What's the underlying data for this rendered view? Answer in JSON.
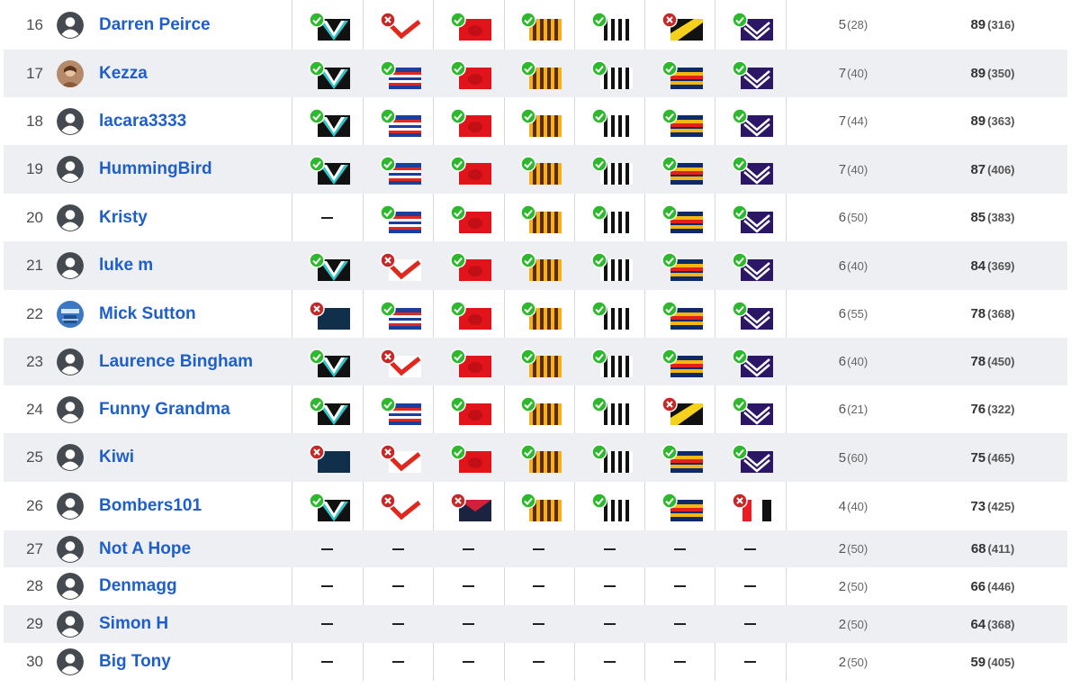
{
  "leaderboard": {
    "rows": [
      {
        "rank": "16",
        "name": "Darren Peirce",
        "avatar": "default",
        "tips": [
          [
            "port",
            "correct"
          ],
          [
            "sydney",
            "wrong"
          ],
          [
            "melbourne",
            "correct"
          ],
          [
            "hawthorn",
            "correct"
          ],
          [
            "collingwood",
            "correct"
          ],
          [
            "richmond",
            "wrong"
          ],
          [
            "fremantle",
            "correct"
          ]
        ],
        "score": "5",
        "score_sub": "(28)",
        "points": "89",
        "points_sub": "(316)"
      },
      {
        "rank": "17",
        "name": "Kezza",
        "avatar": "photo",
        "tips": [
          [
            "port",
            "correct"
          ],
          [
            "bulldogs",
            "correct"
          ],
          [
            "melbourne",
            "correct"
          ],
          [
            "hawthorn",
            "correct"
          ],
          [
            "collingwood",
            "correct"
          ],
          [
            "adelaide",
            "correct"
          ],
          [
            "fremantle",
            "correct"
          ]
        ],
        "score": "7",
        "score_sub": "(40)",
        "points": "89",
        "points_sub": "(350)"
      },
      {
        "rank": "18",
        "name": "lacara3333",
        "avatar": "default",
        "tips": [
          [
            "port",
            "correct"
          ],
          [
            "bulldogs",
            "correct"
          ],
          [
            "melbourne",
            "correct"
          ],
          [
            "hawthorn",
            "correct"
          ],
          [
            "collingwood",
            "correct"
          ],
          [
            "adelaide",
            "correct"
          ],
          [
            "fremantle",
            "correct"
          ]
        ],
        "score": "7",
        "score_sub": "(44)",
        "points": "89",
        "points_sub": "(363)"
      },
      {
        "rank": "19",
        "name": "HummingBird",
        "avatar": "default",
        "tips": [
          [
            "port",
            "correct"
          ],
          [
            "bulldogs",
            "correct"
          ],
          [
            "melbourne",
            "correct"
          ],
          [
            "hawthorn",
            "correct"
          ],
          [
            "collingwood",
            "correct"
          ],
          [
            "adelaide",
            "correct"
          ],
          [
            "fremantle",
            "correct"
          ]
        ],
        "score": "7",
        "score_sub": "(40)",
        "points": "87",
        "points_sub": "(406)"
      },
      {
        "rank": "20",
        "name": "Kristy",
        "avatar": "default",
        "tips": [
          [
            "none",
            ""
          ],
          [
            "bulldogs",
            "correct"
          ],
          [
            "melbourne",
            "correct"
          ],
          [
            "hawthorn",
            "correct"
          ],
          [
            "collingwood",
            "correct"
          ],
          [
            "adelaide",
            "correct"
          ],
          [
            "fremantle",
            "correct"
          ]
        ],
        "score": "6",
        "score_sub": "(50)",
        "points": "85",
        "points_sub": "(383)"
      },
      {
        "rank": "21",
        "name": "luke m",
        "avatar": "default",
        "tips": [
          [
            "port",
            "correct"
          ],
          [
            "sydney",
            "wrong"
          ],
          [
            "melbourne",
            "correct"
          ],
          [
            "hawthorn",
            "correct"
          ],
          [
            "collingwood",
            "correct"
          ],
          [
            "adelaide",
            "correct"
          ],
          [
            "fremantle",
            "correct"
          ]
        ],
        "score": "6",
        "score_sub": "(40)",
        "points": "84",
        "points_sub": "(369)"
      },
      {
        "rank": "22",
        "name": "Mick Sutton",
        "avatar": "photo2",
        "tips": [
          [
            "navy",
            "wrong"
          ],
          [
            "bulldogs",
            "correct"
          ],
          [
            "melbourne",
            "correct"
          ],
          [
            "hawthorn",
            "correct"
          ],
          [
            "collingwood",
            "correct"
          ],
          [
            "adelaide",
            "correct"
          ],
          [
            "fremantle",
            "correct"
          ]
        ],
        "score": "6",
        "score_sub": "(55)",
        "points": "78",
        "points_sub": "(368)"
      },
      {
        "rank": "23",
        "name": "Laurence Bingham",
        "avatar": "default",
        "tips": [
          [
            "port",
            "correct"
          ],
          [
            "sydney",
            "wrong"
          ],
          [
            "melbourne",
            "correct"
          ],
          [
            "hawthorn",
            "correct"
          ],
          [
            "collingwood",
            "correct"
          ],
          [
            "adelaide",
            "correct"
          ],
          [
            "fremantle",
            "correct"
          ]
        ],
        "score": "6",
        "score_sub": "(40)",
        "points": "78",
        "points_sub": "(450)"
      },
      {
        "rank": "24",
        "name": "Funny Grandma",
        "avatar": "default",
        "tips": [
          [
            "port",
            "correct"
          ],
          [
            "bulldogs",
            "correct"
          ],
          [
            "melbourne",
            "correct"
          ],
          [
            "hawthorn",
            "correct"
          ],
          [
            "collingwood",
            "correct"
          ],
          [
            "richmond",
            "wrong"
          ],
          [
            "fremantle",
            "correct"
          ]
        ],
        "score": "6",
        "score_sub": "(21)",
        "points": "76",
        "points_sub": "(322)"
      },
      {
        "rank": "25",
        "name": "Kiwi",
        "avatar": "default",
        "tips": [
          [
            "navy",
            "wrong"
          ],
          [
            "sydney",
            "wrong"
          ],
          [
            "melbourne",
            "correct"
          ],
          [
            "hawthorn",
            "correct"
          ],
          [
            "collingwood",
            "correct"
          ],
          [
            "adelaide",
            "correct"
          ],
          [
            "fremantle",
            "correct"
          ]
        ],
        "score": "5",
        "score_sub": "(60)",
        "points": "75",
        "points_sub": "(465)"
      },
      {
        "rank": "26",
        "name": "Bombers101",
        "avatar": "default",
        "tips": [
          [
            "port",
            "correct"
          ],
          [
            "sydney",
            "wrong"
          ],
          [
            "redv",
            "wrong"
          ],
          [
            "hawthorn",
            "correct"
          ],
          [
            "collingwood",
            "correct"
          ],
          [
            "adelaide",
            "correct"
          ],
          [
            "stkilda",
            "wrong"
          ]
        ],
        "score": "4",
        "score_sub": "(40)",
        "points": "73",
        "points_sub": "(425)"
      },
      {
        "rank": "27",
        "name": "Not A Hope",
        "avatar": "default",
        "tips": [
          [
            "none",
            ""
          ],
          [
            "none",
            ""
          ],
          [
            "none",
            ""
          ],
          [
            "none",
            ""
          ],
          [
            "none",
            ""
          ],
          [
            "none",
            ""
          ],
          [
            "none",
            ""
          ]
        ],
        "score": "2",
        "score_sub": "(50)",
        "points": "68",
        "points_sub": "(411)"
      },
      {
        "rank": "28",
        "name": "Denmagg",
        "avatar": "default",
        "tips": [
          [
            "none",
            ""
          ],
          [
            "none",
            ""
          ],
          [
            "none",
            ""
          ],
          [
            "none",
            ""
          ],
          [
            "none",
            ""
          ],
          [
            "none",
            ""
          ],
          [
            "none",
            ""
          ]
        ],
        "score": "2",
        "score_sub": "(50)",
        "points": "66",
        "points_sub": "(446)"
      },
      {
        "rank": "29",
        "name": "Simon H",
        "avatar": "default",
        "tips": [
          [
            "none",
            ""
          ],
          [
            "none",
            ""
          ],
          [
            "none",
            ""
          ],
          [
            "none",
            ""
          ],
          [
            "none",
            ""
          ],
          [
            "none",
            ""
          ],
          [
            "none",
            ""
          ]
        ],
        "score": "2",
        "score_sub": "(50)",
        "points": "64",
        "points_sub": "(368)"
      },
      {
        "rank": "30",
        "name": "Big Tony",
        "avatar": "default",
        "tips": [
          [
            "none",
            ""
          ],
          [
            "none",
            ""
          ],
          [
            "none",
            ""
          ],
          [
            "none",
            ""
          ],
          [
            "none",
            ""
          ],
          [
            "none",
            ""
          ],
          [
            "none",
            ""
          ]
        ],
        "score": "2",
        "score_sub": "(50)",
        "points": "59",
        "points_sub": "(405)"
      }
    ]
  },
  "colors": {
    "link": "#1e5fcc",
    "row_alt": "#eeeff2",
    "correct": "#2eb82e",
    "wrong": "#c62828",
    "grid": "#d8d8d8"
  }
}
